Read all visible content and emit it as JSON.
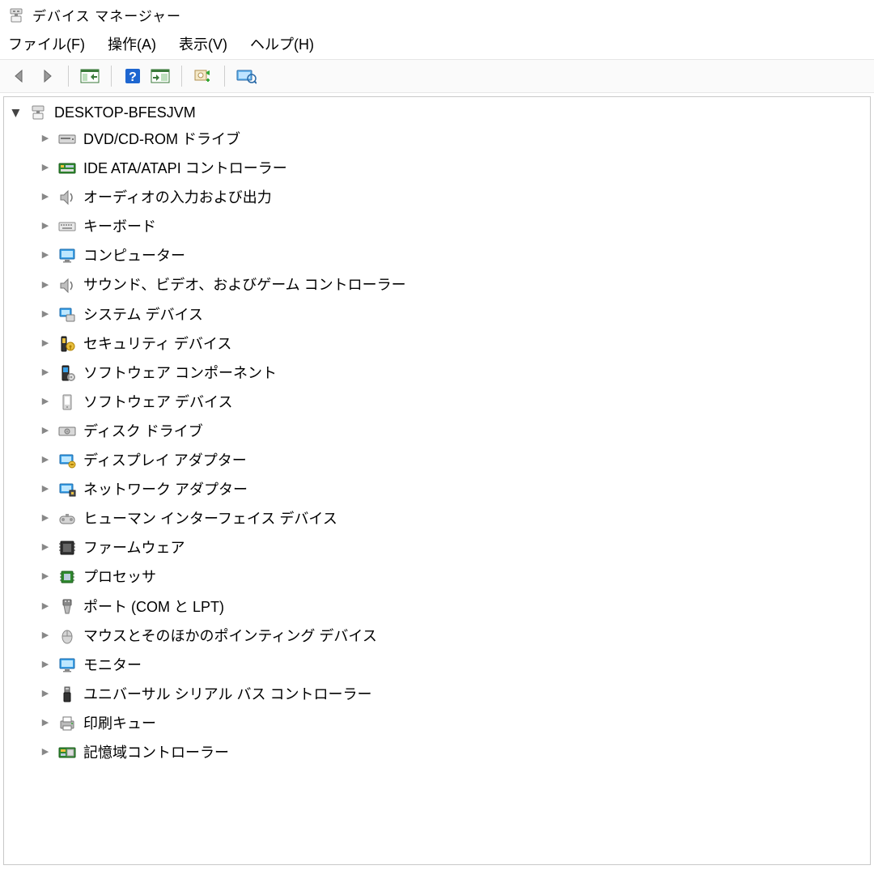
{
  "window": {
    "title": "デバイス マネージャー"
  },
  "menu": {
    "file": "ファイル(F)",
    "action": "操作(A)",
    "view": "表示(V)",
    "help": "ヘルプ(H)"
  },
  "toolbar": {
    "back": "back-arrow",
    "forward": "forward-arrow",
    "show_hide": "show-hide-console-tree",
    "help": "help",
    "preview": "action-preview",
    "scan": "scan-hardware",
    "show_hidden": "show-hidden-devices"
  },
  "tree": {
    "root": "DESKTOP-BFESJVM",
    "items": [
      {
        "label": "DVD/CD-ROM ドライブ",
        "icon": "dvd-drive"
      },
      {
        "label": "IDE ATA/ATAPI コントローラー",
        "icon": "ide-controller"
      },
      {
        "label": "オーディオの入力および出力",
        "icon": "audio-io"
      },
      {
        "label": "キーボード",
        "icon": "keyboard"
      },
      {
        "label": "コンピューター",
        "icon": "computer"
      },
      {
        "label": "サウンド、ビデオ、およびゲーム コントローラー",
        "icon": "sound-video"
      },
      {
        "label": "システム デバイス",
        "icon": "system-device"
      },
      {
        "label": "セキュリティ デバイス",
        "icon": "security-device"
      },
      {
        "label": "ソフトウェア コンポーネント",
        "icon": "software-component"
      },
      {
        "label": "ソフトウェア デバイス",
        "icon": "software-device"
      },
      {
        "label": "ディスク ドライブ",
        "icon": "disk-drive"
      },
      {
        "label": "ディスプレイ アダプター",
        "icon": "display-adapter"
      },
      {
        "label": "ネットワーク アダプター",
        "icon": "network-adapter"
      },
      {
        "label": "ヒューマン インターフェイス デバイス",
        "icon": "hid"
      },
      {
        "label": "ファームウェア",
        "icon": "firmware"
      },
      {
        "label": "プロセッサ",
        "icon": "processor"
      },
      {
        "label": "ポート (COM と LPT)",
        "icon": "port"
      },
      {
        "label": "マウスとそのほかのポインティング デバイス",
        "icon": "mouse"
      },
      {
        "label": "モニター",
        "icon": "monitor"
      },
      {
        "label": "ユニバーサル シリアル バス コントローラー",
        "icon": "usb-controller"
      },
      {
        "label": "印刷キュー",
        "icon": "print-queue"
      },
      {
        "label": "記憶域コントローラー",
        "icon": "storage-controller"
      }
    ]
  }
}
